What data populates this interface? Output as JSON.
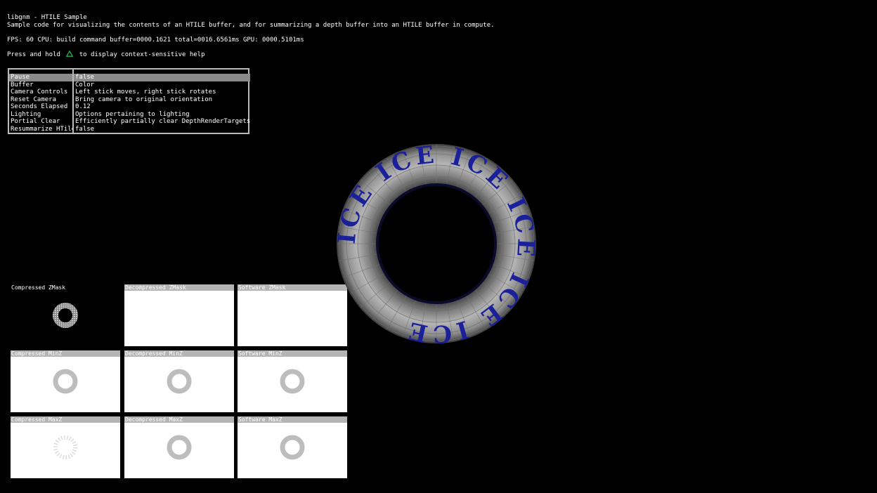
{
  "header": {
    "title": "libgnm - HTILE Sample",
    "description": "Sample code for visualizing the contents of an HTILE buffer, and for summarizing a depth buffer into an HTILE buffer in compute.",
    "stats": "FPS:  60 CPU: build command buffer=0000.1621 total=0016.6561ms GPU: 0000.5101ms",
    "help_prefix": "Press and hold",
    "help_suffix": "to display context-sensitive help"
  },
  "menu": {
    "items": [
      {
        "label": "Pause",
        "value": "false",
        "selected": true
      },
      {
        "label": "Buffer",
        "value": "Color"
      },
      {
        "label": "Camera Controls",
        "value": "Left stick moves, right stick rotates"
      },
      {
        "label": "Reset Camera",
        "value": "Bring camera to original orientation"
      },
      {
        "label": "Seconds Elapsed",
        "value": "0.12"
      },
      {
        "label": "Lighting",
        "value": "Options pertaining to lighting"
      },
      {
        "label": "Portial Clear",
        "value": "Efficiently partially clear DepthRenderTargets"
      },
      {
        "label": "Resummarize HTile",
        "value": "false"
      }
    ]
  },
  "panels": [
    {
      "title": "Compressed ZMask",
      "ring": "dark",
      "style": "dark"
    },
    {
      "title": "Decompressed ZMask",
      "ring": "none",
      "style": "light"
    },
    {
      "title": "Software ZMask",
      "ring": "none",
      "style": "light"
    },
    {
      "title": "Compressed MinZ",
      "ring": "gray",
      "style": "light"
    },
    {
      "title": "Decompressed MinZ",
      "ring": "gray",
      "style": "light"
    },
    {
      "title": "Software MinZ",
      "ring": "gray",
      "style": "light"
    },
    {
      "title": "Compressed MaxZ",
      "ring": "faint",
      "style": "light"
    },
    {
      "title": "Decompressed MaxZ",
      "ring": "gray",
      "style": "light"
    },
    {
      "title": "Software MaxZ",
      "ring": "gray",
      "style": "light"
    }
  ],
  "scene": {
    "torus_text": "ICE",
    "text_color": "#1a1f9a",
    "torus_color": "#9a9a9a"
  },
  "colors": {
    "help_triangle": "#22b14c"
  }
}
